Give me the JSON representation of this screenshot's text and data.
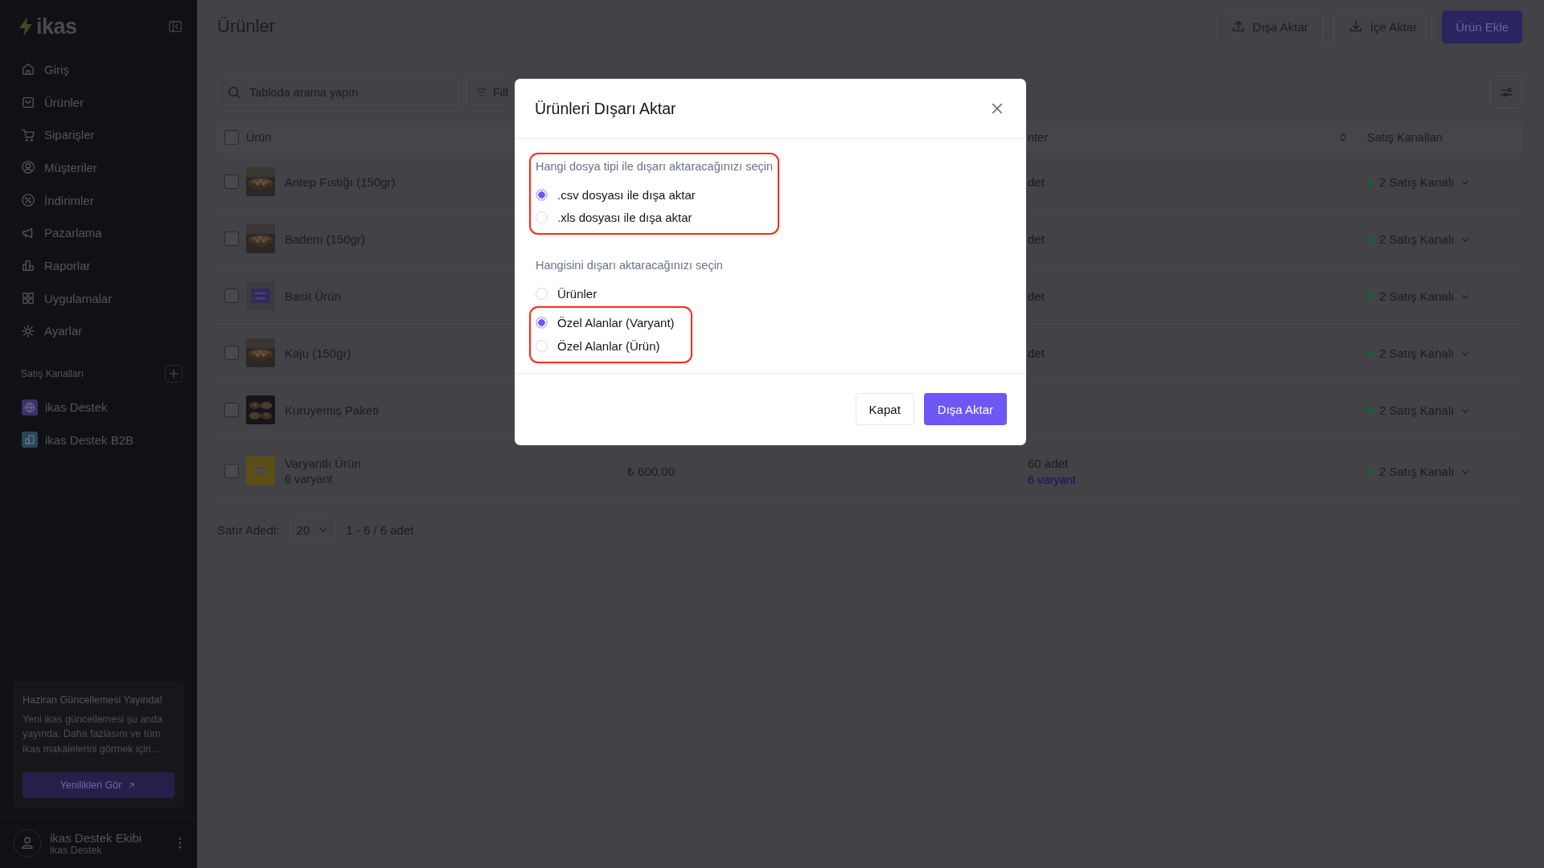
{
  "sidebar": {
    "logo": "ikas",
    "nav": [
      "Giriş",
      "Ürünler",
      "Siparişler",
      "Müşteriler",
      "İndirimler",
      "Pazarlama",
      "Raporlar",
      "Uygulamalar",
      "Ayarlar"
    ],
    "channels_title": "Satış Kanalları",
    "channels": [
      {
        "label": "ikas Destek",
        "color": "#3a3366"
      },
      {
        "label": "ikas Destek B2B",
        "color": "#2b4756"
      }
    ],
    "update_card": {
      "title": "Haziran Güncellemesi Yayında!",
      "text": "Yeni ikas güncellemesi şu anda yayında. Daha fazlasını ve tüm ikas makalelerini görmek için...",
      "button": "Yenilikleri Gör"
    },
    "user": {
      "name": "ikas Destek Ekibi",
      "subtitle": "ikas Destek"
    }
  },
  "page": {
    "title": "Ürünler",
    "actions": [
      {
        "label": "Dışa Aktar",
        "kind": "export"
      },
      {
        "label": "İçe Aktar",
        "kind": "import"
      },
      {
        "label": "Ürün Ekle",
        "kind": "primary"
      }
    ],
    "search": {
      "placeholder": "Tabloda arama yapın"
    },
    "filter": "Filt",
    "table": {
      "select_all_checked": false,
      "columns": {
        "product": "Ürün",
        "stock": "nter",
        "channels": "Satış Kanalları"
      },
      "rows": [
        {
          "checked": false,
          "name": "Antep Fıstığı (150gr)",
          "stock": "det",
          "channels": "2 Satış Kanalı"
        },
        {
          "checked": false,
          "name": "Badem (150gr)",
          "stock": "det",
          "channels": "2 Satış Kanalı"
        },
        {
          "checked": false,
          "name": "Basit Ürün",
          "stock": "det",
          "channels": "2 Satış Kanalı"
        },
        {
          "checked": false,
          "name": "Kaju (150gr)",
          "stock": "det",
          "channels": "2 Satış Kanalı"
        },
        {
          "checked": false,
          "name": "Kuruyemiş Paketi",
          "channels": "2 Satış Kanalı"
        },
        {
          "checked": false,
          "name": "Varyantlı Ürün",
          "subtitle": "6 varyant",
          "price": "₺ 600.00",
          "stock": "60 adet",
          "stock_link": "6 varyant",
          "channels": "2 Satış Kanalı"
        }
      ]
    },
    "footer": {
      "rows_label": "Satır Adedi:",
      "page_size": "20",
      "range": "1 - 6 / 6 adet"
    }
  },
  "modal": {
    "title": "Ürünleri Dışarı Aktar",
    "groups": [
      {
        "label": "Hangi dosya tipi ile dışarı aktaracağınızı seçin",
        "label_highlighted": true,
        "options": [
          {
            "label": ".csv dosyası ile dışa aktar",
            "selected": true,
            "highlighted": true
          },
          {
            "label": ".xls dosyası ile dışa aktar",
            "selected": false,
            "highlighted": true
          }
        ]
      },
      {
        "label": "Hangisini dışarı aktaracağınızı seçin",
        "label_highlighted": false,
        "options": [
          {
            "label": "Ürünler",
            "selected": false,
            "highlighted": false
          },
          {
            "label": "Özel Alanlar (Varyant)",
            "selected": true,
            "highlighted": true
          },
          {
            "label": "Özel Alanlar (Ürün)",
            "selected": false,
            "highlighted": true
          }
        ]
      }
    ],
    "buttons": [
      {
        "label": "Kapat",
        "kind": "secondary"
      },
      {
        "label": "Dışa Aktar",
        "kind": "primary"
      }
    ]
  }
}
